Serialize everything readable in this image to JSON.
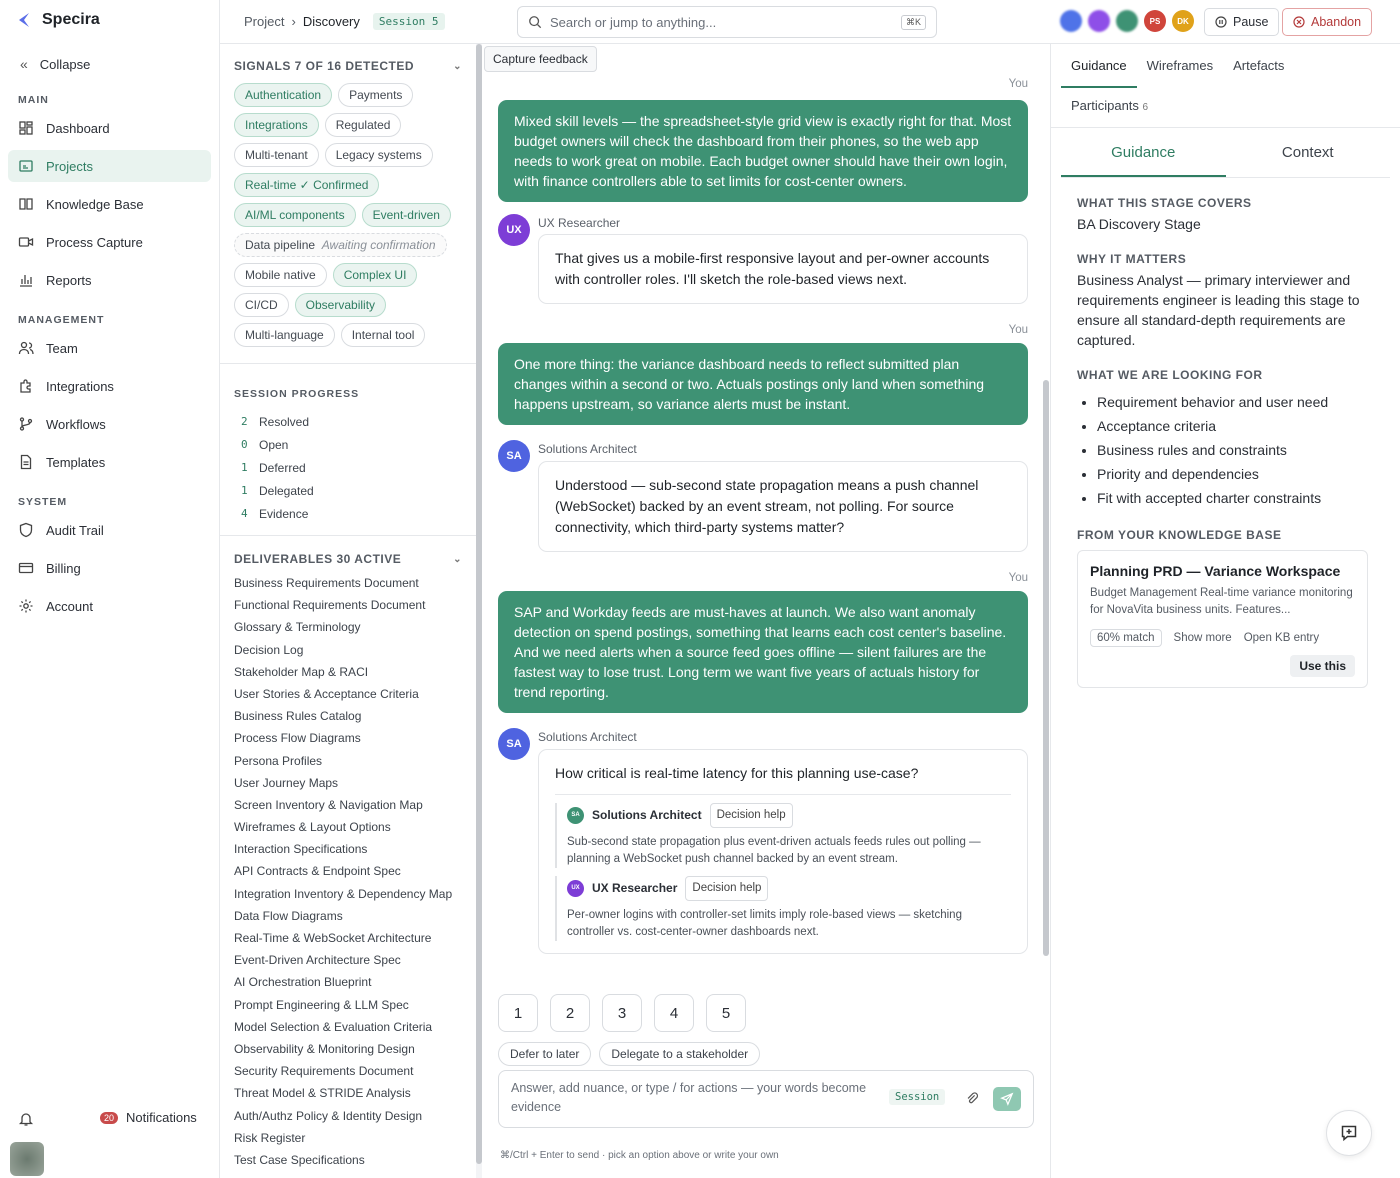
{
  "brand": {
    "name": "Specira"
  },
  "nav": {
    "collapse": "Collapse",
    "main_label": "MAIN",
    "main": [
      {
        "label": "Dashboard"
      },
      {
        "label": "Projects"
      },
      {
        "label": "Knowledge Base"
      },
      {
        "label": "Process Capture"
      },
      {
        "label": "Reports"
      }
    ],
    "management_label": "MANAGEMENT",
    "management": [
      {
        "label": "Team"
      },
      {
        "label": "Integrations"
      },
      {
        "label": "Workflows"
      },
      {
        "label": "Templates"
      }
    ],
    "system_label": "SYSTEM",
    "system": [
      {
        "label": "Audit Trail"
      },
      {
        "label": "Billing"
      },
      {
        "label": "Account"
      }
    ],
    "notifications_label": "Notifications",
    "notifications_count": "20"
  },
  "topbar": {
    "crumb_project": "Project",
    "crumb_sep": "›",
    "crumb_current": "Discovery",
    "session": "Session 5",
    "search_placeholder": "Search or jump to anything...",
    "search_kbd": "⌘K",
    "avatars": [
      {
        "initials": "",
        "color": "#4f73e8"
      },
      {
        "initials": "",
        "color": "#8e4fe8"
      },
      {
        "initials": "",
        "color": "#3e9274"
      },
      {
        "initials": "PS",
        "color": "#d0453b"
      },
      {
        "initials": "DK",
        "color": "#e0a21a"
      }
    ],
    "pause_label": "Pause",
    "abandon_label": "Abandon"
  },
  "signals": {
    "title": "SIGNALS 7 OF 16 DETECTED",
    "chips": [
      {
        "label": "Authentication",
        "on": true
      },
      {
        "label": "Payments",
        "on": false
      },
      {
        "label": "Integrations",
        "on": true
      },
      {
        "label": "Regulated",
        "on": false
      },
      {
        "label": "Multi-tenant",
        "on": false
      },
      {
        "label": "Legacy systems",
        "on": false
      },
      {
        "label": "Real-time ✓ Confirmed",
        "on": true
      },
      {
        "label": "AI/ML components",
        "on": true
      },
      {
        "label": "Event-driven",
        "on": true
      },
      {
        "label": "Data pipeline",
        "sub": "Awaiting confirmation",
        "on": false
      },
      {
        "label": "Mobile native",
        "on": false
      },
      {
        "label": "Complex UI",
        "on": true
      },
      {
        "label": "CI/CD",
        "on": false
      },
      {
        "label": "Observability",
        "on": true
      },
      {
        "label": "Multi-language",
        "on": false
      },
      {
        "label": "Internal tool",
        "on": false
      }
    ]
  },
  "progress": {
    "title": "SESSION PROGRESS",
    "rows": [
      {
        "n": "2",
        "label": "Resolved"
      },
      {
        "n": "0",
        "label": "Open"
      },
      {
        "n": "1",
        "label": "Deferred"
      },
      {
        "n": "1",
        "label": "Delegated"
      },
      {
        "n": "4",
        "label": "Evidence"
      }
    ]
  },
  "deliverables": {
    "title": "DELIVERABLES 30 ACTIVE",
    "items": [
      "Business Requirements Document",
      "Functional Requirements Document",
      "Glossary & Terminology",
      "Decision Log",
      "Stakeholder Map & RACI",
      "User Stories & Acceptance Criteria",
      "Business Rules Catalog",
      "Process Flow Diagrams",
      "Persona Profiles",
      "User Journey Maps",
      "Screen Inventory & Navigation Map",
      "Wireframes & Layout Options",
      "Interaction Specifications",
      "API Contracts & Endpoint Spec",
      "Integration Inventory & Dependency Map",
      "Data Flow Diagrams",
      "Real-Time & WebSocket Architecture",
      "Event-Driven Architecture Spec",
      "AI Orchestration Blueprint",
      "Prompt Engineering & LLM Spec",
      "Model Selection & Evaluation Criteria",
      "Observability & Monitoring Design",
      "Security Requirements Document",
      "Threat Model & STRIDE Analysis",
      "Auth/Authz Policy & Identity Design",
      "Risk Register",
      "Test Case Specifications"
    ]
  },
  "chat": {
    "capture_feedback": "Capture feedback",
    "you_label": "You",
    "msg1": "Mixed skill levels — the spreadsheet-style grid view is exactly right for that. Most budget owners will check the dashboard from their phones, so the web app needs to work great on mobile. Each budget owner should have their own login, with finance controllers able to set limits for cost-center owners.",
    "ux_role": "UX Researcher",
    "ux_initials": "UX",
    "msg2": "That gives us a mobile-first responsive layout and per-owner accounts with controller roles. I'll sketch the role-based views next.",
    "msg3": "One more thing: the variance dashboard needs to reflect submitted plan changes within a second or two. Actuals postings only land when something happens upstream, so variance alerts must be instant.",
    "sa_role": "Solutions Architect",
    "sa_initials": "SA",
    "msg4": "Understood — sub-second state propagation means a push channel (WebSocket) backed by an event stream, not polling. For source connectivity, which third-party systems matter?",
    "msg5": "SAP and Workday feeds are must-haves at launch. We also want anomaly detection on spend postings, something that learns each cost center's baseline. And we need alerts when a source feed goes offline — silent failures are the fastest way to lose trust. Long term we want five years of actuals history for trend reporting.",
    "msg6": "How critical is real-time latency for this planning use-case?",
    "decision_help": "Decision help",
    "help_sa": "Sub-second state propagation plus event-driven actuals feeds rules out polling — planning a WebSocket push channel backed by an event stream.",
    "help_ux": "Per-owner logins with controller-set limits imply role-based views — sketching controller vs. cost-center-owner dashboards next.",
    "options": [
      "1",
      "2",
      "3",
      "4",
      "5"
    ],
    "defer_label": "Defer to later",
    "delegate_label": "Delegate to a stakeholder",
    "composer_placeholder": "Answer, add nuance, or type / for actions — your words become evidence",
    "composer_session": "Session",
    "hint": "⌘/Ctrl + Enter to send · pick an option above or write your own"
  },
  "right": {
    "tabs": [
      "Guidance",
      "Wireframes",
      "Artefacts"
    ],
    "participants_label": "Participants",
    "participants_count": "6",
    "subtabs": [
      "Guidance",
      "Context"
    ],
    "covers_h": "WHAT THIS STAGE COVERS",
    "covers_v": "BA Discovery Stage",
    "why_h": "WHY IT MATTERS",
    "why_v": "Business Analyst — primary interviewer and requirements engineer is leading this stage to ensure all standard-depth requirements are captured.",
    "looking_h": "WHAT WE ARE LOOKING FOR",
    "looking": [
      "Requirement behavior and user need",
      "Acceptance criteria",
      "Business rules and constraints",
      "Priority and dependencies",
      "Fit with accepted charter constraints"
    ],
    "kb_h": "FROM YOUR KNOWLEDGE BASE",
    "kb_title": "Planning PRD — Variance Workspace",
    "kb_desc": "Budget Management Real-time variance monitoring for NovaVita business units. Features...",
    "kb_match": "60% match",
    "kb_show_more": "Show more",
    "kb_open": "Open KB entry",
    "kb_use": "Use this"
  }
}
